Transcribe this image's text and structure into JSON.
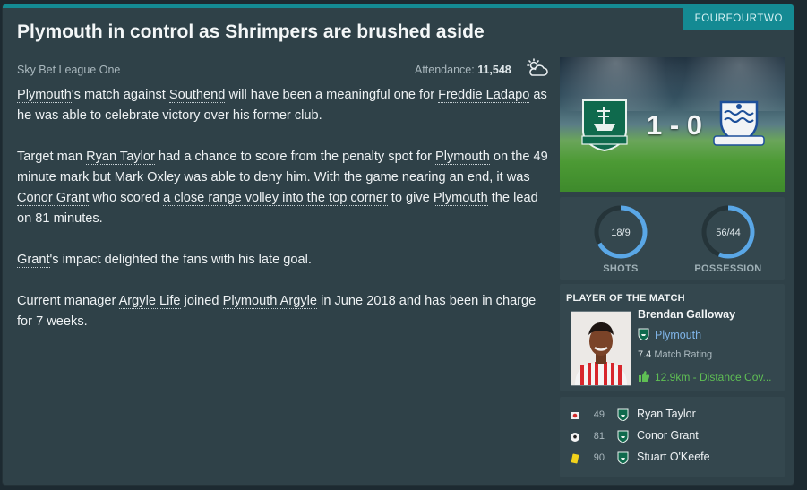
{
  "source": "FOURFOURTWO",
  "headline": "Plymouth in control as Shrimpers are brushed aside",
  "competition": "Sky Bet League One",
  "attendance": {
    "label": "Attendance:",
    "value": "11,548",
    "weather_icon": "partly-cloudy-icon"
  },
  "article": {
    "p1": {
      "t1": "Plymouth",
      "t2": "'s match against ",
      "t3": "Southend",
      "t4": " will have been a meaningful one for ",
      "t5": "Freddie Ladapo",
      "t6": " as he was able to celebrate victory over his former club."
    },
    "p2": {
      "t1": "Target man ",
      "t2": "Ryan Taylor",
      "t3": " had a chance to score from the penalty spot for ",
      "t4": "Plymouth",
      "t5": " on the 49 minute mark but ",
      "t6": "Mark Oxley",
      "t7": " was able to deny him. With the game nearing an end, it was ",
      "t8": "Conor Grant",
      "t9": " who scored ",
      "t10": "a close range volley into the top corner",
      "t11": " to give ",
      "t12": "Plymouth",
      "t13": " the lead on 81 minutes."
    },
    "p3": {
      "t1": "Grant",
      "t2": "'s impact delighted the fans with his late goal."
    },
    "p4": {
      "t1": "Current manager ",
      "t2": "Argyle Life",
      "t3": " joined ",
      "t4": "Plymouth Argyle",
      "t5": " in June 2018 and has been in charge for 7 weeks."
    }
  },
  "score": {
    "display": "1 - 0",
    "home_crest": "plymouth-crest-icon",
    "away_crest": "southend-crest-icon"
  },
  "stats": {
    "shots": {
      "value": "18/9",
      "label": "SHOTS",
      "home_share": 0.67
    },
    "possession": {
      "value": "56/44",
      "label": "POSSESSION",
      "home_share": 0.56
    }
  },
  "potm": {
    "title": "PLAYER OF THE MATCH",
    "name": "Brendan Galloway",
    "club": "Plymouth",
    "rating_value": "7.4",
    "rating_label": "Match Rating",
    "distance": "12.9km - Distance Cov..."
  },
  "events": [
    {
      "icon": "missed-penalty-icon",
      "minute": "49",
      "player": "Ryan Taylor"
    },
    {
      "icon": "goal-ball-icon",
      "minute": "81",
      "player": "Conor Grant"
    },
    {
      "icon": "yellow-card-icon",
      "minute": "90",
      "player": "Stuart O'Keefe"
    }
  ],
  "colors": {
    "accent": "#148a93",
    "panel": "#2f4148",
    "dial_fill": "#5aa7e6",
    "positive": "#5fbf54"
  }
}
